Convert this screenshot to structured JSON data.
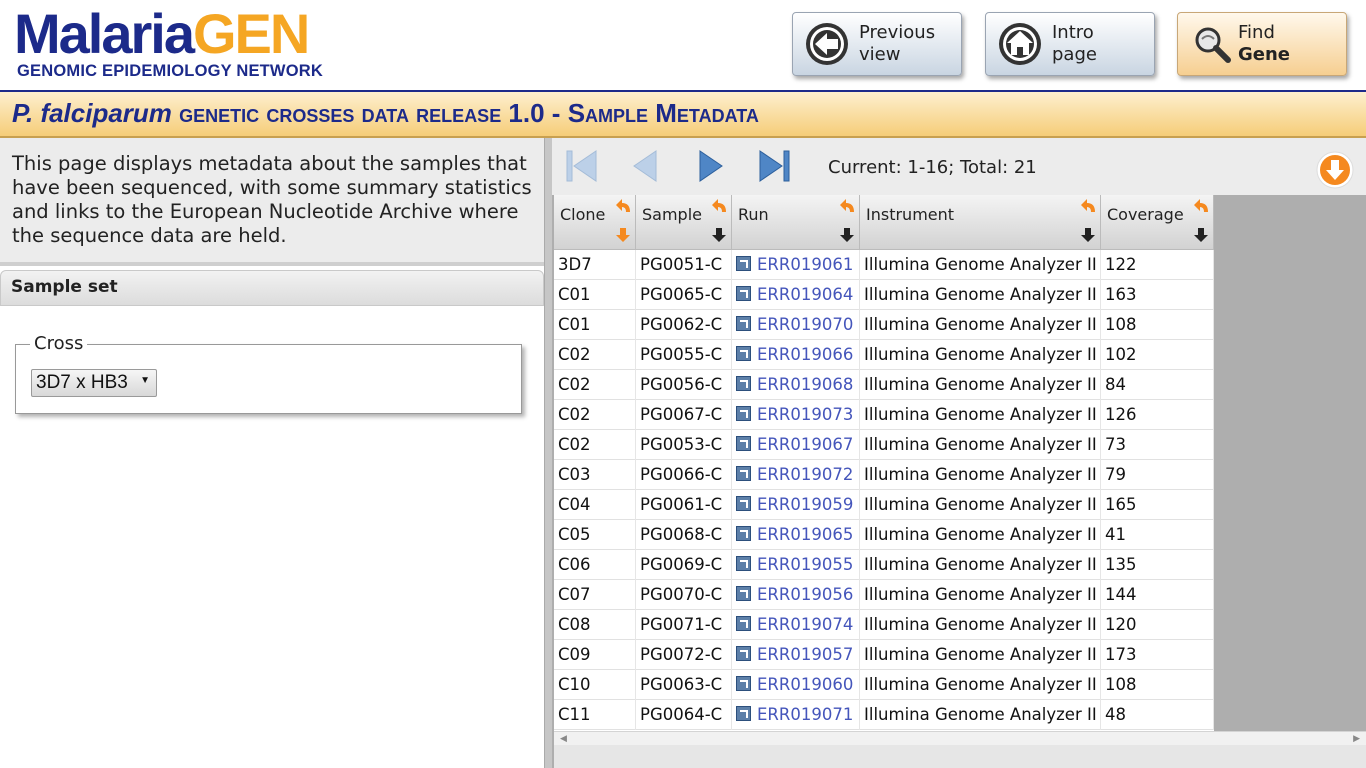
{
  "logo": {
    "part1": "Malaria",
    "part2": "GEN",
    "subtitle": "GENOMIC EPIDEMIOLOGY NETWORK"
  },
  "header_buttons": {
    "previous": {
      "line1": "Previous",
      "line2": "view",
      "icon": "arrow-left-icon"
    },
    "intro": {
      "line1": "Intro",
      "line2": "page",
      "icon": "home-icon"
    },
    "find": {
      "line1": "Find",
      "line2": "Gene",
      "icon": "magnifier-icon"
    }
  },
  "title": {
    "species": "P. falciparum",
    "rest": " genetic crosses data release ",
    "version": "1.0",
    "dash": " - ",
    "section": "Sample Metadata"
  },
  "intro_text": "This page displays metadata about the samples that have been sequenced, with some summary statistics and links to the European Nucleotide Archive where the sequence data are held.",
  "sample_set": {
    "header": "Sample set",
    "legend": "Cross",
    "selected": "3D7 x HB3"
  },
  "pager": {
    "info": "Current: 1-16; Total: 21"
  },
  "table": {
    "columns": [
      "Clone",
      "Sample",
      "Run",
      "Instrument",
      "Coverage"
    ],
    "rows": [
      [
        "3D7",
        "PG0051-C",
        "ERR019061",
        "Illumina Genome Analyzer II",
        "122"
      ],
      [
        "C01",
        "PG0065-C",
        "ERR019064",
        "Illumina Genome Analyzer II",
        "163"
      ],
      [
        "C01",
        "PG0062-C",
        "ERR019070",
        "Illumina Genome Analyzer II",
        "108"
      ],
      [
        "C02",
        "PG0055-C",
        "ERR019066",
        "Illumina Genome Analyzer II",
        "102"
      ],
      [
        "C02",
        "PG0056-C",
        "ERR019068",
        "Illumina Genome Analyzer II",
        "84"
      ],
      [
        "C02",
        "PG0067-C",
        "ERR019073",
        "Illumina Genome Analyzer II",
        "126"
      ],
      [
        "C02",
        "PG0053-C",
        "ERR019067",
        "Illumina Genome Analyzer II",
        "73"
      ],
      [
        "C03",
        "PG0066-C",
        "ERR019072",
        "Illumina Genome Analyzer II",
        "79"
      ],
      [
        "C04",
        "PG0061-C",
        "ERR019059",
        "Illumina Genome Analyzer II",
        "165"
      ],
      [
        "C05",
        "PG0068-C",
        "ERR019065",
        "Illumina Genome Analyzer II",
        "41"
      ],
      [
        "C06",
        "PG0069-C",
        "ERR019055",
        "Illumina Genome Analyzer II",
        "135"
      ],
      [
        "C07",
        "PG0070-C",
        "ERR019056",
        "Illumina Genome Analyzer II",
        "144"
      ],
      [
        "C08",
        "PG0071-C",
        "ERR019074",
        "Illumina Genome Analyzer II",
        "120"
      ],
      [
        "C09",
        "PG0072-C",
        "ERR019057",
        "Illumina Genome Analyzer II",
        "173"
      ],
      [
        "C10",
        "PG0063-C",
        "ERR019060",
        "Illumina Genome Analyzer II",
        "108"
      ],
      [
        "C11",
        "PG0064-C",
        "ERR019071",
        "Illumina Genome Analyzer II",
        "48"
      ]
    ]
  },
  "colors": {
    "brand_blue": "#1c2a8a",
    "brand_orange": "#f5a623",
    "link": "#4455bb"
  }
}
